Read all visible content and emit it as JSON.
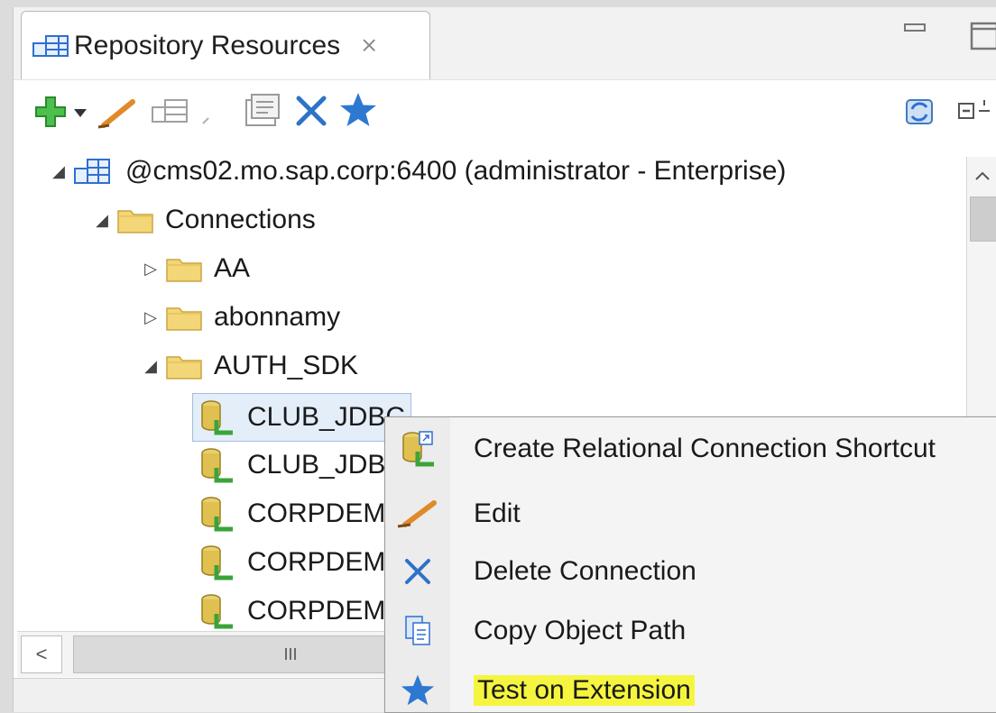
{
  "view": {
    "tab_title": "Repository Resources",
    "tab_close_glyph": "⨯"
  },
  "toolbar": {
    "icons": [
      "add-icon",
      "dropdown-arrow-icon",
      "edit-icon",
      "connection-shortcut-icon",
      "small-dot-icon",
      "properties-icon",
      "delete-icon",
      "star-icon",
      "refresh-icon",
      "collapse-all-icon"
    ]
  },
  "tree": {
    "root": "@cms02.mo.sap.corp:6400 (administrator - Enterprise)",
    "connections_folder": "Connections",
    "folders": [
      "AA",
      "abonnamy",
      "AUTH_SDK"
    ],
    "connections": [
      "CLUB_JDBC",
      "CLUB_JDB",
      "CORPDEM",
      "CORPDEM",
      "CORPDEM"
    ]
  },
  "hscroll": {
    "left_arrow": "<",
    "thumb_grip": "III"
  },
  "context_menu": {
    "items": [
      {
        "label": "Create Relational Connection Shortcut",
        "icon": "shortcut-icon"
      },
      {
        "label": "Edit",
        "icon": "pencil-icon"
      },
      {
        "label": "Delete Connection",
        "icon": "delete-x-icon"
      },
      {
        "label": "Copy Object Path",
        "icon": "copy-icon"
      },
      {
        "label": "Test on Extension",
        "icon": "star-icon",
        "highlighted": true
      }
    ]
  },
  "colors": {
    "selection_bg": "#e4eef9",
    "highlight": "#f5f540",
    "icon_blue": "#2d73c7",
    "folder_yellow": "#f3d678"
  }
}
